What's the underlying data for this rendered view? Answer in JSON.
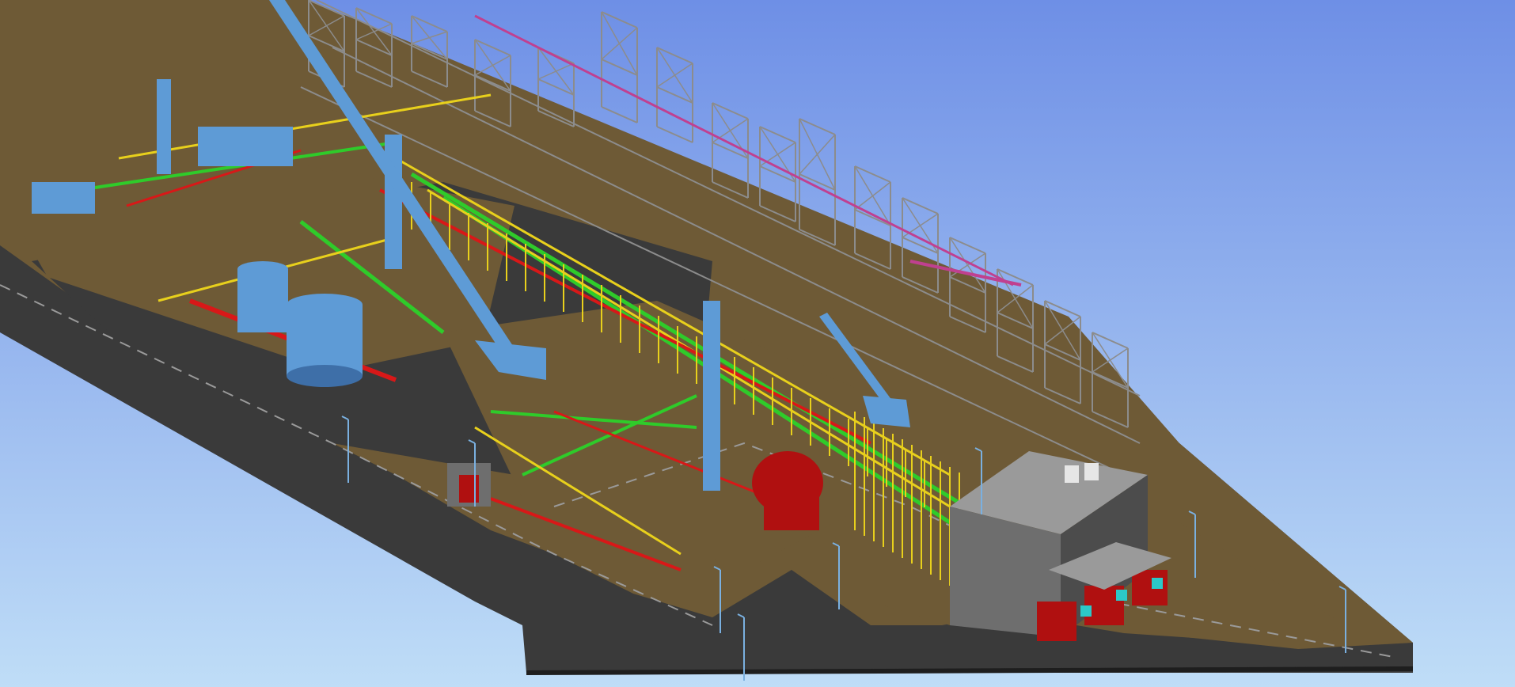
{
  "viewport": {
    "background": {
      "top_color": "#6E8FE6",
      "bottom_color": "#BFDDF7"
    }
  },
  "palette": {
    "ground": "#6E5A36",
    "road": "#3A3A3A",
    "road_edge": "#1E1E1E",
    "road_marking": "#9A9A9A",
    "steel_frame": "#8C8C8C",
    "pipe_green": "#2FCB2A",
    "pipe_yellow": "#E8D01C",
    "pipe_red": "#D81818",
    "equipment_blue": "#5E9BD6",
    "equipment_red": "#B01010",
    "building_gray": "#6E6E6E",
    "hvac_cyan": "#2CC8C8",
    "magenta_pipe": "#C04090"
  },
  "model": {
    "zones": [
      {
        "id": "process-area-west"
      },
      {
        "id": "tank-farm"
      },
      {
        "id": "process-area-central"
      },
      {
        "id": "pipe-rack"
      },
      {
        "id": "steel-structure-north"
      },
      {
        "id": "electrical-building"
      }
    ]
  }
}
